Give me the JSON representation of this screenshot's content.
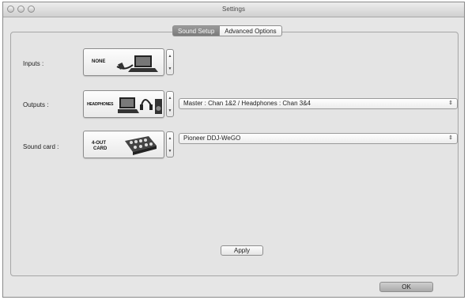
{
  "window": {
    "title": "Settings"
  },
  "tabs": [
    {
      "label": "Sound Setup",
      "active": true
    },
    {
      "label": "Advanced Options",
      "active": false
    }
  ],
  "inputs": {
    "label": "Inputs :",
    "device_text": "NONE"
  },
  "outputs": {
    "label": "Outputs :",
    "device_text": "HEADPHONES",
    "routing_value": "Master : Chan 1&2 / Headphones : Chan 3&4"
  },
  "sound_card": {
    "label": "Sound card :",
    "device_text_1": "4-OUT",
    "device_text_2": "CARD",
    "selected_value": "Pioneer DDJ-WeGO"
  },
  "buttons": {
    "apply": "Apply",
    "ok": "OK"
  },
  "icons": {
    "stepper_up": "▲",
    "stepper_down": "▼",
    "popup_arrows": "⇕"
  }
}
